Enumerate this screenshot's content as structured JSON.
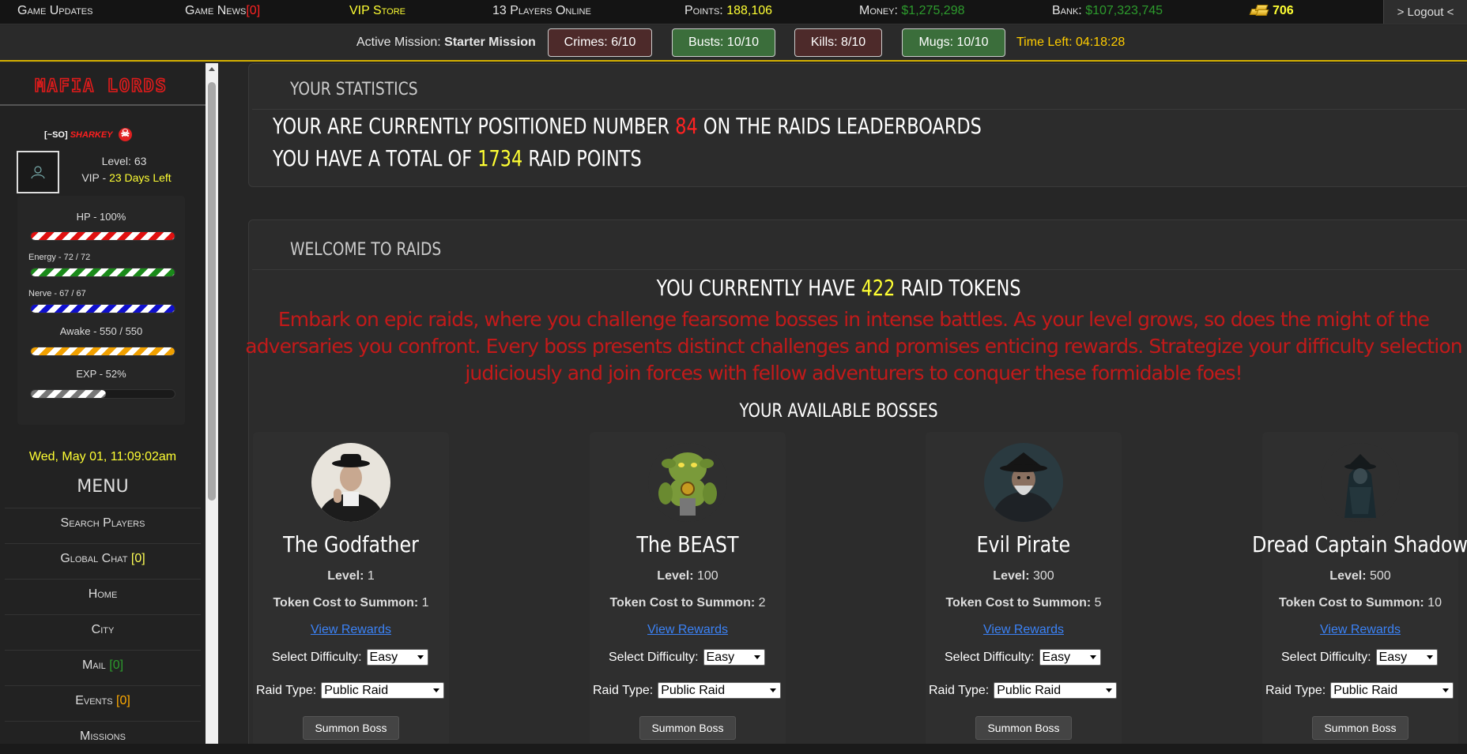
{
  "topbar": {
    "game_updates": "Game Updates",
    "game_news": "Game News",
    "game_news_count": "[0]",
    "vip_store": "VIP Store",
    "players_online": "13 Players Online",
    "points_label": "Points:",
    "points_value": "188,106",
    "money_label": "Money:",
    "money_value": "$1,275,298",
    "bank_label": "Bank:",
    "bank_value": "$107,323,745",
    "gold_value": "706",
    "logout": "> Logout <"
  },
  "mission": {
    "label": "Active Mission:",
    "name": "Starter Mission",
    "crimes": "Crimes: 6/10",
    "busts": "Busts: 10/10",
    "kills": "Kills: 8/10",
    "mugs": "Mugs: 10/10",
    "time_left": "Time Left: 04:18:28"
  },
  "sidebar": {
    "logo_text": "MAFIA LORDS",
    "user_tag": "[~SO]",
    "user_name": "SHARKEY",
    "level": "Level: 63",
    "vip_prefix": "VIP - ",
    "vip_days": "23 Days Left",
    "bars": {
      "hp_label": "HP - 100%",
      "hp_fraction": 1.0,
      "energy_label": "Energy - 72 / 72",
      "energy_fraction": 1.0,
      "nerve_label": "Nerve - 67 / 67",
      "nerve_fraction": 1.0,
      "awake_label": "Awake - 550 / 550",
      "awake_fraction": 1.0,
      "exp_label": "EXP - 52%",
      "exp_fraction": 0.52
    },
    "datetime": "Wed, May 01, 11:09:02am",
    "menu_title": "MENU",
    "menu": {
      "search": "Search Players",
      "chat": "Global Chat",
      "chat_count": "[0]",
      "home": "Home",
      "city": "City",
      "mail": "Mail",
      "mail_count": "[0]",
      "events": "Events",
      "events_count": "[0]",
      "missions": "Missions"
    }
  },
  "stats": {
    "title": "Your Statistics",
    "rank_prefix": "Your are currently positioned number ",
    "rank_value": "84",
    "rank_suffix": " on the raids leaderboards",
    "points_prefix": "You have a total of ",
    "points_value": "1734",
    "points_suffix": " raid points"
  },
  "raids": {
    "title": "Welcome to Raids",
    "tokens_prefix": "You currently have ",
    "tokens_value": "422",
    "tokens_suffix": " raid tokens",
    "description": "Embark on epic raids, where you challenge fearsome bosses in intense battles. As your level grows, so does the might of the adversaries you confront. Every boss presents distinct challenges and promises enticing rewards. Strategize your difficulty selection judiciously and join forces with fellow adventurers to conquer these formidable foes!",
    "bosses_title": "Your Available Bosses",
    "labels": {
      "level": "Level:",
      "cost": "Token Cost to Summon:",
      "rewards": "View Rewards",
      "difficulty": "Select Difficulty:",
      "raid_type": "Raid Type:",
      "summon": "Summon Boss"
    },
    "bosses": [
      {
        "name": "The Godfather",
        "level": "1",
        "cost": "1",
        "difficulty": "Easy",
        "raid_type": "Public Raid"
      },
      {
        "name": "The BEAST",
        "level": "100",
        "cost": "2",
        "difficulty": "Easy",
        "raid_type": "Public Raid"
      },
      {
        "name": "Evil Pirate",
        "level": "300",
        "cost": "5",
        "difficulty": "Easy",
        "raid_type": "Public Raid"
      },
      {
        "name": "Dread Captain Shadow",
        "level": "500",
        "cost": "10",
        "difficulty": "Easy",
        "raid_type": "Public Raid"
      }
    ]
  },
  "colors": {
    "accent_yellow": "#ffff33",
    "money_green": "#2d9b2d",
    "alert_red": "#ff2222",
    "description_red": "#c21a1a",
    "link_blue": "#3b82f6"
  }
}
